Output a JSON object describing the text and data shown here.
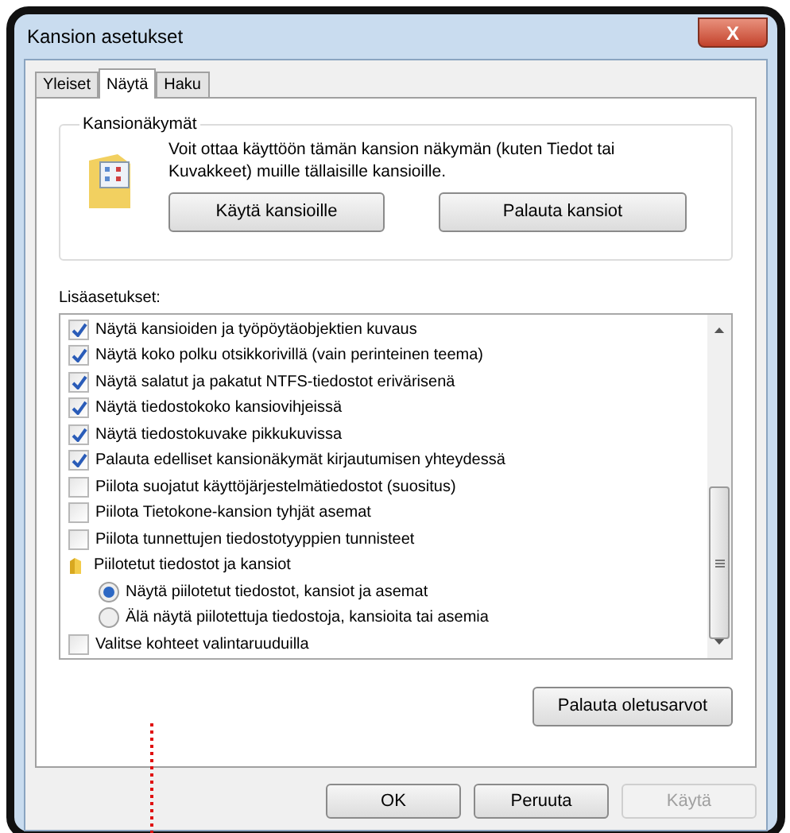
{
  "window": {
    "title": "Kansion asetukset",
    "close": "X"
  },
  "tabs": [
    {
      "label": "Yleiset",
      "selected": false
    },
    {
      "label": "Näytä",
      "selected": true
    },
    {
      "label": "Haku",
      "selected": false
    }
  ],
  "folder_views": {
    "title": "Kansionäkymät",
    "description": "Voit ottaa käyttöön tämän kansion näkymän (kuten Tiedot tai Kuvakkeet) muille tällaisille kansioille.",
    "buttons": [
      "Käytä kansioille",
      "Palauta kansiot"
    ]
  },
  "advanced": {
    "title": "Lisäasetukset:",
    "items": [
      {
        "kind": "checkbox",
        "label": "Näytä kansioiden ja työpöytäobjektien kuvaus",
        "checked": true
      },
      {
        "kind": "checkbox",
        "label": "Näytä koko polku otsikkorivillä (vain perinteinen teema)",
        "checked": true
      },
      {
        "kind": "checkbox",
        "label": "Näytä salatut ja pakatut NTFS-tiedostot erivärisenä",
        "checked": true
      },
      {
        "kind": "checkbox",
        "label": "Näytä tiedostokoko kansiovihjeissä",
        "checked": true
      },
      {
        "kind": "checkbox",
        "label": "Näytä tiedostokuvake pikkukuvissa",
        "checked": true
      },
      {
        "kind": "checkbox",
        "label": "Palauta edelliset kansionäkymät kirjautumisen yhteydessä",
        "checked": true
      },
      {
        "kind": "checkbox",
        "label": "Piilota suojatut käyttöjärjestelmätiedostot (suositus)",
        "checked": false
      },
      {
        "kind": "checkbox",
        "label": "Piilota Tietokone-kansion tyhjät asemat",
        "checked": false
      },
      {
        "kind": "checkbox",
        "label": "Piilota tunnettujen tiedostotyyppien tunnisteet",
        "checked": false
      },
      {
        "kind": "folder",
        "label": "Piilotetut tiedostot ja kansiot",
        "children": [
          {
            "kind": "radio",
            "label": "Näytä piilotetut tiedostot, kansiot ja asemat",
            "selected": true
          },
          {
            "kind": "radio",
            "label": "Älä näytä piilotettuja tiedostoja, kansioita tai asemia",
            "selected": false
          }
        ]
      },
      {
        "kind": "checkbox",
        "label": "Valitse kohteet valintaruuduilla",
        "checked": false
      }
    ],
    "reset_button": "Palauta oletusarvot"
  },
  "buttons": [
    {
      "label": "OK",
      "disabled": false
    },
    {
      "label": "Peruuta",
      "disabled": false
    },
    {
      "label": "Käytä",
      "disabled": true
    }
  ]
}
